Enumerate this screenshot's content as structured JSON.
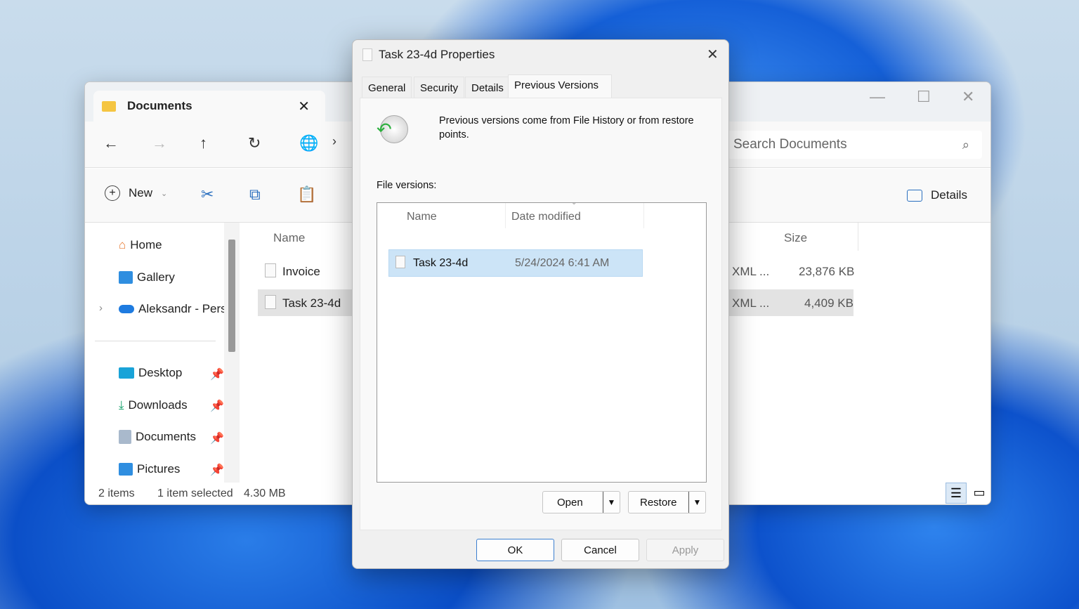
{
  "explorer": {
    "tab_title": "Documents",
    "search_placeholder": "Search Documents",
    "new_label": "New",
    "details_label": "Details",
    "sidebar": [
      {
        "label": "Home",
        "icon": "home-icon"
      },
      {
        "label": "Gallery",
        "icon": "gallery-icon"
      },
      {
        "label": "Aleksandr - Pers",
        "icon": "onedrive-icon"
      },
      {
        "label": "Desktop",
        "icon": "desktop-icon"
      },
      {
        "label": "Downloads",
        "icon": "downloads-icon"
      },
      {
        "label": "Documents",
        "icon": "documents-icon"
      },
      {
        "label": "Pictures",
        "icon": "pictures-icon"
      }
    ],
    "columns": {
      "name": "Name",
      "size": "Size"
    },
    "files": [
      {
        "name": "Invoice",
        "type": "XML ...",
        "size": "23,876 KB"
      },
      {
        "name": "Task 23-4d",
        "type": "XML ...",
        "size": "4,409 KB"
      }
    ],
    "status": {
      "items": "2 items",
      "selected": "1 item selected",
      "size": "4.30 MB"
    }
  },
  "dialog": {
    "title": "Task 23-4d Properties",
    "tabs": [
      "General",
      "Security",
      "Details",
      "Previous Versions"
    ],
    "active_tab": "Previous Versions",
    "info": "Previous versions come from File History or from restore points.",
    "versions_label": "File versions:",
    "columns": {
      "name": "Name",
      "date": "Date modified"
    },
    "versions": [
      {
        "name": "Task 23-4d",
        "date": "5/24/2024 6:41 AM"
      }
    ],
    "open_label": "Open",
    "restore_label": "Restore",
    "ok_label": "OK",
    "cancel_label": "Cancel",
    "apply_label": "Apply"
  }
}
